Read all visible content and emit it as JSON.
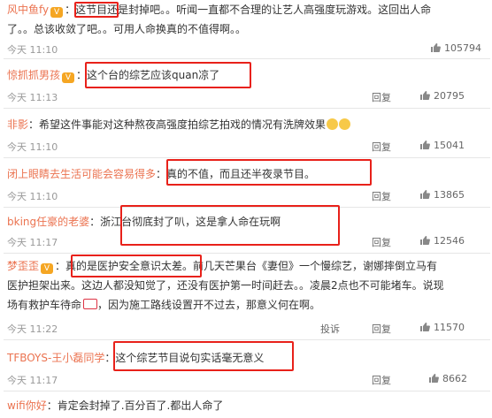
{
  "comments": [
    {
      "user": "风中鱼fy",
      "lines": [
        "：这节目还是封掉吧。。听闻一直都不合理的让艺人高强度玩游戏。这回出人命",
        "了。。总该收敛了吧。。可用人命换真的不值得啊。。"
      ],
      "time": "今天 11:10",
      "likes": "105794"
    },
    {
      "user": "惊抓抓男孩",
      "lines": [
        "：这个台的综艺应该quan凉了"
      ],
      "time": "今天 11:13",
      "reply": "回复",
      "likes": "20795"
    },
    {
      "user": "非影",
      "lines": [
        "：希望这件事能对这种熬夜高强度拍综艺拍戏的情况有洗牌效果"
      ],
      "time": "今天 11:10",
      "reply": "回复",
      "likes": "15041"
    },
    {
      "user": "闭上眼睛去生活可能会容易得多",
      "lines": [
        "：真的不值，而且还半夜录节目。"
      ],
      "time": "今天 11:10",
      "reply": "回复",
      "likes": "13865"
    },
    {
      "user": "bking任豪的老婆",
      "lines": [
        "：浙江台彻底封了叭，这是拿人命在玩啊"
      ],
      "time": "今天 11:17",
      "reply": "回复",
      "likes": "12546"
    },
    {
      "user": "梦歪歪",
      "lines": [
        "：真的是医护安全意识太差。前几天芒果台《妻但》一个慢综艺，谢娜摔倒立马有",
        "医护担架出来。这边人都没知觉了，还没有医护第一时间赶去。。凌晨2点也不可能堵车。说现",
        "场有救护车待命",
        "，因为施工路线设置开不过去，那意义何在啊。"
      ],
      "time": "今天 11:22",
      "report": "投诉",
      "reply": "回复",
      "likes": "11570"
    },
    {
      "user": "TFBOYS-王小磊同学",
      "lines": [
        "：这个综艺节目说句实话毫无意义"
      ],
      "time": "今天 11:17",
      "reply": "回复",
      "likes": "8662"
    },
    {
      "user": "wifi你好",
      "lines": [
        "：肯定会封掉了.百分百了.都出人命了"
      ]
    }
  ],
  "colors": {
    "username": "#eb7350",
    "highlight": "#e8211a",
    "meta": "#999999"
  }
}
